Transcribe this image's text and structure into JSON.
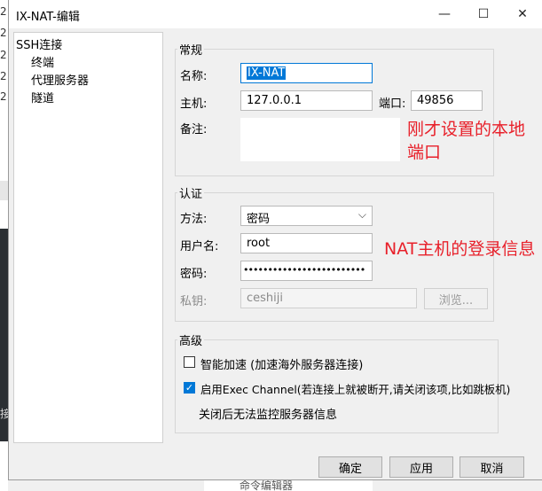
{
  "window": {
    "title": "IX-NAT-编辑"
  },
  "titlebar": {
    "minimize_glyph": "—",
    "maximize_glyph": "☐",
    "close_glyph": "✕"
  },
  "sidebar": {
    "items": [
      {
        "label": "SSH连接"
      },
      {
        "label": "终端"
      },
      {
        "label": "代理服务器"
      },
      {
        "label": "隧道"
      }
    ]
  },
  "general": {
    "heading": "常规",
    "name_label": "名称:",
    "name_value": "IX-NAT",
    "host_label": "主机:",
    "host_value": "127.0.0.1",
    "port_label": "端口:",
    "port_value": "49856",
    "note_label": "备注:",
    "note_value": ""
  },
  "auth": {
    "heading": "认证",
    "method_label": "方法:",
    "method_value": "密码",
    "username_label": "用户名:",
    "username_value": "root",
    "password_label": "密码:",
    "password_value": "•••••••••••••••••••••••••",
    "key_label": "私钥:",
    "key_value": "ceshiji",
    "browse_label": "浏览..."
  },
  "advanced": {
    "heading": "高级",
    "smart_accel_label": "智能加速 (加速海外服务器连接)",
    "smart_accel_checked": false,
    "exec_channel_label": "启用Exec Channel(若连接上就被断开,请关闭该项,比如跳板机)",
    "exec_channel_checked": true,
    "exec_channel_note": "关闭后无法监控服务器信息"
  },
  "footer": {
    "ok_label": "确定",
    "apply_label": "应用",
    "cancel_label": "取消"
  },
  "annotations": {
    "port_note": "刚才设置的本地端口",
    "login_note": "NAT主机的登录信息"
  },
  "background": {
    "left_glyphs": [
      "2",
      "2",
      "2",
      "2",
      "2",
      "接"
    ],
    "bottom_text": "命令编辑器"
  },
  "colors": {
    "accent": "#0078d7",
    "annotation": "#e8202a"
  }
}
